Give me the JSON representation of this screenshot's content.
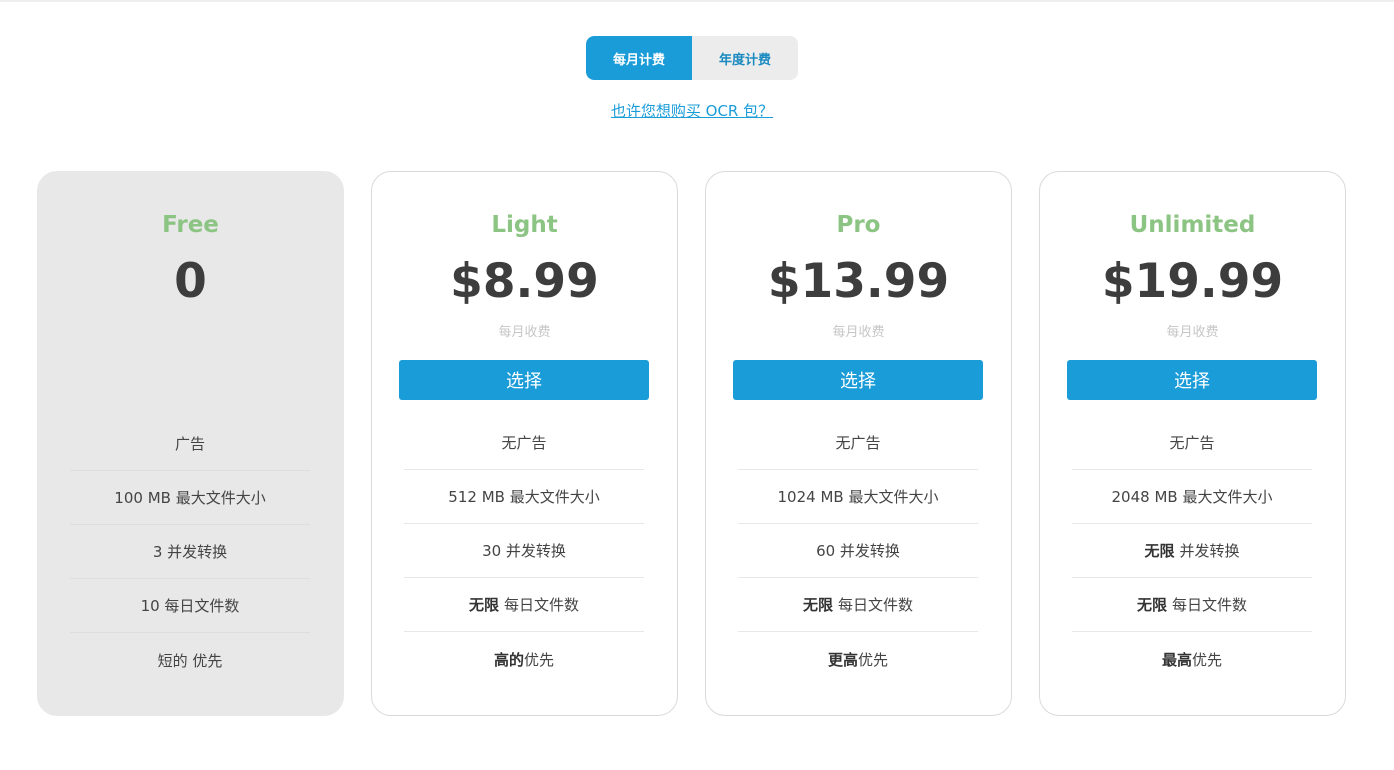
{
  "billing_toggle": {
    "monthly_label": "每月计费",
    "yearly_label": "年度计费"
  },
  "ocr_link": "也许您想购买 OCR 包？",
  "plans": [
    {
      "name": "Free",
      "price": "0",
      "period": "",
      "button": "",
      "features": [
        {
          "strong": "",
          "text": "广告"
        },
        {
          "strong": "",
          "text": "100 MB 最大文件大小"
        },
        {
          "strong": "",
          "text": "3 并发转换"
        },
        {
          "strong": "",
          "text": "10 每日文件数"
        },
        {
          "strong": "",
          "text": "短的 优先"
        }
      ]
    },
    {
      "name": "Light",
      "price": "$8.99",
      "period": "每月收费",
      "button": "选择",
      "features": [
        {
          "strong": "",
          "text": "无广告"
        },
        {
          "strong": "",
          "text": "512 MB 最大文件大小"
        },
        {
          "strong": "",
          "text": "30 并发转换"
        },
        {
          "strong": "无限",
          "text": "每日文件数"
        },
        {
          "strong": "高的",
          "text": "优先"
        }
      ]
    },
    {
      "name": "Pro",
      "price": "$13.99",
      "period": "每月收费",
      "button": "选择",
      "features": [
        {
          "strong": "",
          "text": "无广告"
        },
        {
          "strong": "",
          "text": "1024 MB 最大文件大小"
        },
        {
          "strong": "",
          "text": "60 并发转换"
        },
        {
          "strong": "无限",
          "text": "每日文件数"
        },
        {
          "strong": "更高",
          "text": "优先"
        }
      ]
    },
    {
      "name": "Unlimited",
      "price": "$19.99",
      "period": "每月收费",
      "button": "选择",
      "features": [
        {
          "strong": "",
          "text": "无广告"
        },
        {
          "strong": "",
          "text": "2048 MB 最大文件大小"
        },
        {
          "strong": "无限",
          "text": "并发转换"
        },
        {
          "strong": "无限",
          "text": "每日文件数"
        },
        {
          "strong": "最高",
          "text": "优先"
        }
      ]
    }
  ],
  "colors": {
    "accent": "#1a9cd8",
    "plan_name": "#8cc583",
    "price": "#3d3d3d",
    "free_card_bg": "#e8e8e8"
  }
}
